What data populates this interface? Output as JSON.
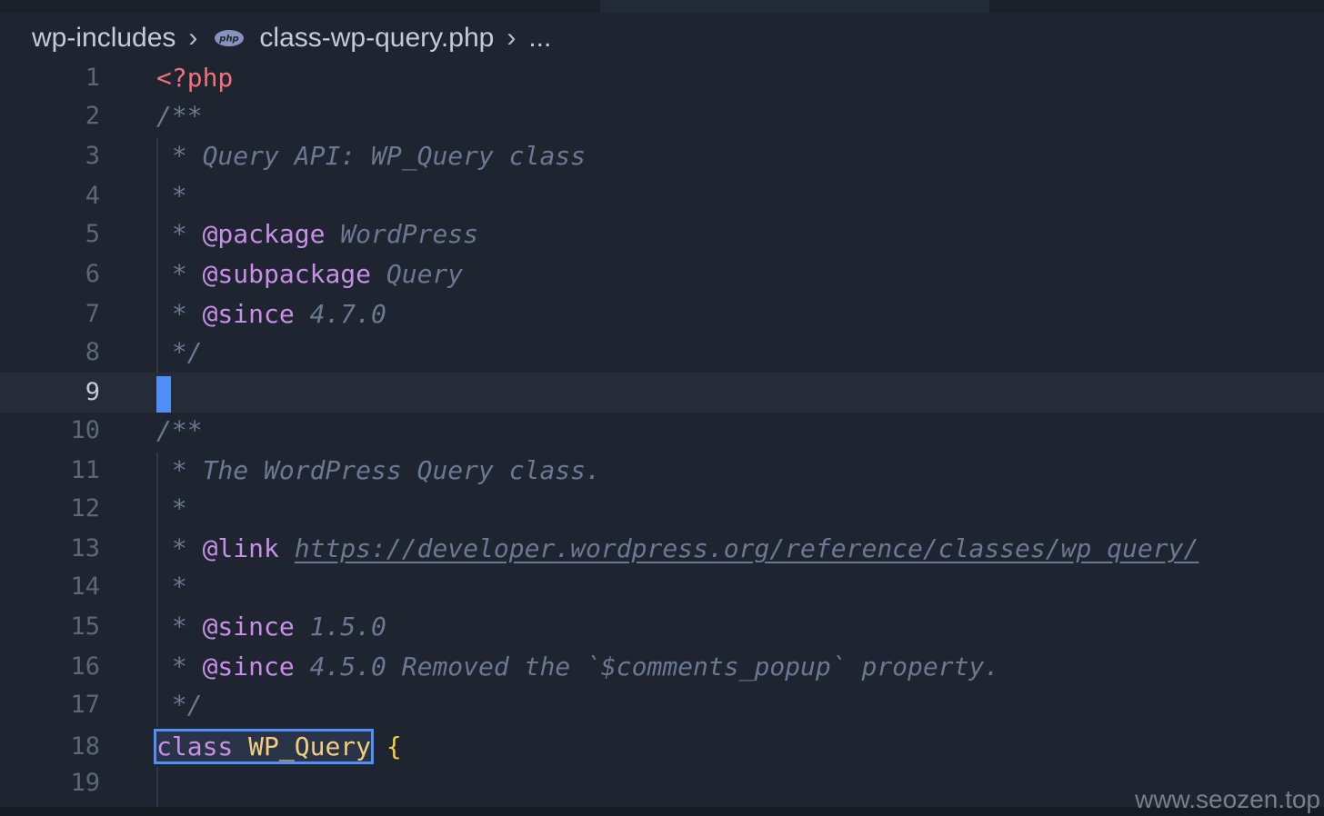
{
  "breadcrumb": {
    "folder": "wp-includes",
    "file_icon": "php-icon",
    "file_icon_text": "php",
    "file": "class-wp-query.php",
    "more": "..."
  },
  "editor": {
    "current_line": 9,
    "lines": [
      {
        "n": "1"
      },
      {
        "n": "2"
      },
      {
        "n": "3"
      },
      {
        "n": "4"
      },
      {
        "n": "5"
      },
      {
        "n": "6"
      },
      {
        "n": "7"
      },
      {
        "n": "8"
      },
      {
        "n": "9"
      },
      {
        "n": "10"
      },
      {
        "n": "11"
      },
      {
        "n": "12"
      },
      {
        "n": "13"
      },
      {
        "n": "14"
      },
      {
        "n": "15"
      },
      {
        "n": "16"
      },
      {
        "n": "17"
      },
      {
        "n": "18"
      },
      {
        "n": "19"
      }
    ],
    "code": {
      "l1": "<?php",
      "l2": "/**",
      "l3_star": " * ",
      "l3_text": "Query API: WP_Query class",
      "l4": " *",
      "l5_star": " * ",
      "l5_tag": "@package",
      "l5_text": " WordPress",
      "l6_star": " * ",
      "l6_tag": "@subpackage",
      "l6_text": " Query",
      "l7_star": " * ",
      "l7_tag": "@since",
      "l7_text": " 4.7.0",
      "l8": " */",
      "l10": "/**",
      "l11_star": " * ",
      "l11_text": "The WordPress Query class.",
      "l12": " *",
      "l13_star": " * ",
      "l13_tag": "@link",
      "l13_sp": " ",
      "l13_url": "https://developer.wordpress.org/reference/classes/wp_query/",
      "l14": " *",
      "l15_star": " * ",
      "l15_tag": "@since",
      "l15_text": " 1.5.0",
      "l16_star": " * ",
      "l16_tag": "@since",
      "l16_text": " 4.5.0 Removed the `$comments_popup` property.",
      "l17": " */",
      "l18_kw": "class",
      "l18_sp": " ",
      "l18_name": "WP_Query",
      "l18_brace": " {"
    }
  },
  "watermark": "www.seozen.top",
  "colors": {
    "background": "#1e2430",
    "comment": "#6b7891",
    "doc_tag": "#c88fe6",
    "keyword": "#c88fe6",
    "class_name": "#f2ce7e",
    "php_open_tag": "#f07178",
    "cursor": "#4f8ff7"
  }
}
